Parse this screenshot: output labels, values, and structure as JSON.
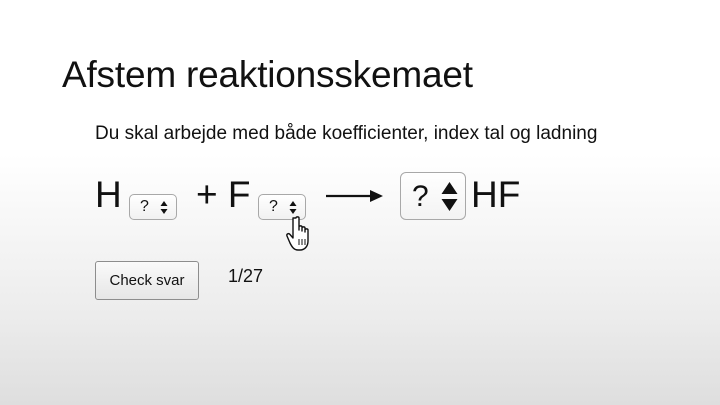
{
  "page": {
    "title": "Afstem reaktionsskemaet",
    "instruction": "Du skal arbejde med både koefficienter, index tal og ladning"
  },
  "equation": {
    "reactant1_symbol": "H",
    "reactant1_index_select": {
      "value": "?"
    },
    "plus": "+ F",
    "reactant2_index_select": {
      "value": "?"
    },
    "product_coefficient_select": {
      "value": "?"
    },
    "product_symbol": "HF"
  },
  "controls": {
    "check_button_label": "Check svar",
    "progress": "1/27"
  },
  "icons": {
    "arrow": "reaction-arrow-icon",
    "cursor": "hand-pointer-cursor-icon",
    "stepper": "up-down-stepper-icon"
  }
}
